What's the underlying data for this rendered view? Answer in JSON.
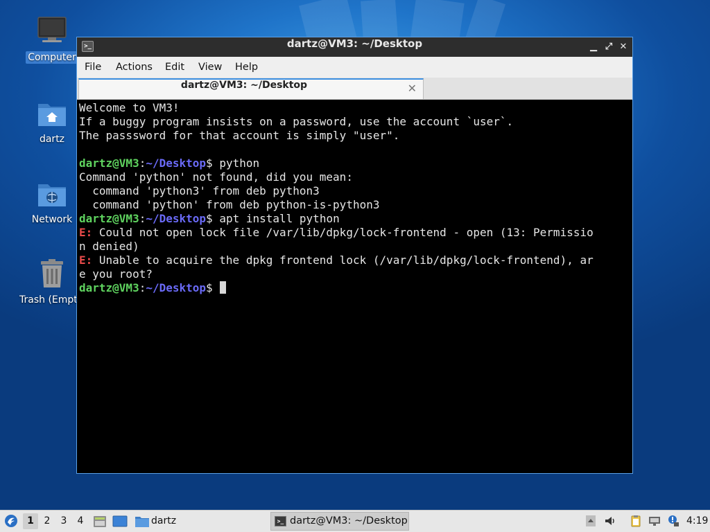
{
  "desktop": {
    "icons": [
      {
        "label": "Computer",
        "icon": "computer-icon"
      },
      {
        "label": "dartz",
        "icon": "home-folder-icon"
      },
      {
        "label": "Network",
        "icon": "network-folder-icon"
      },
      {
        "label": "Trash (Empty)",
        "icon": "trash-icon"
      }
    ]
  },
  "window": {
    "title": "dartz@VM3: ~/Desktop",
    "controls": {
      "minimize": "▁",
      "maximize": "⤢",
      "close": "✕"
    },
    "menu": [
      "File",
      "Actions",
      "Edit",
      "View",
      "Help"
    ],
    "tab": {
      "label": "dartz@VM3: ~/Desktop",
      "close": "✕"
    }
  },
  "terminal": {
    "prompt": {
      "user": "dartz@VM3",
      "sep": ":",
      "path": "~/Desktop",
      "sym": "$"
    },
    "lines": [
      {
        "t": "text",
        "s": "Welcome to VM3!"
      },
      {
        "t": "text",
        "s": "If a buggy program insists on a password, use the account `user`."
      },
      {
        "t": "text",
        "s": "The passsword for that account is simply \"user\"."
      },
      {
        "t": "text",
        "s": ""
      },
      {
        "t": "prompt",
        "cmd": " python"
      },
      {
        "t": "text",
        "s": "Command 'python' not found, did you mean:"
      },
      {
        "t": "text",
        "s": "  command 'python3' from deb python3"
      },
      {
        "t": "text",
        "s": "  command 'python' from deb python-is-python3"
      },
      {
        "t": "prompt",
        "cmd": " apt install python"
      },
      {
        "t": "error",
        "tag": "E:",
        "s": " Could not open lock file /var/lib/dpkg/lock-frontend - open (13: Permissio"
      },
      {
        "t": "text",
        "s": "n denied)"
      },
      {
        "t": "error",
        "tag": "E:",
        "s": " Unable to acquire the dpkg frontend lock (/var/lib/dpkg/lock-frontend), ar"
      },
      {
        "t": "text",
        "s": "e you root?"
      },
      {
        "t": "prompt",
        "cmd": " ",
        "cursor": true
      }
    ]
  },
  "taskbar": {
    "workspaces": [
      "1",
      "2",
      "3",
      "4"
    ],
    "active_workspace": "1",
    "quicklaunch": [
      {
        "label": "dartz",
        "icon": "folder-icon"
      }
    ],
    "task": {
      "label": "dartz@VM3: ~/Desktop",
      "icon": "terminal-icon"
    },
    "clock": "4:19"
  },
  "colors": {
    "prompt_user": "#5fd35f",
    "prompt_path": "#6a6af7",
    "error": "#ea4b4b",
    "desktop_bg": "#1f74c9"
  }
}
